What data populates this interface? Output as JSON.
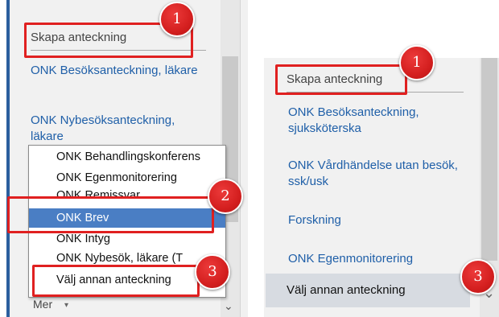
{
  "left": {
    "header": "Skapa anteckning",
    "items": [
      "ONK Besöksanteckning, läkare",
      "ONK Nybesöksanteckning, läkare"
    ],
    "dropdown": [
      {
        "label": "ONK Behandlingskonferens"
      },
      {
        "label": "ONK Egenmonitorering"
      },
      {
        "label": "ONK Remissvar"
      },
      {
        "label": "ONK Brev",
        "selected": true
      },
      {
        "label": "ONK Intyg"
      },
      {
        "label": "ONK Nybesök, läkare (T"
      },
      {
        "label": "Välj annan anteckning"
      }
    ],
    "more_label": "Mer",
    "more_caret": "▾",
    "scroll_down": "⌄"
  },
  "right": {
    "header": "Skapa anteckning",
    "items": [
      "ONK Besöksanteckning, sjuksköterska",
      "ONK Vårdhändelse utan besök, ssk/usk",
      "Forskning",
      "ONK Egenmonitorering"
    ],
    "other_label": "Välj annan anteckning",
    "scroll_down": "⌄"
  },
  "badges": [
    "1",
    "2",
    "3",
    "1",
    "3"
  ],
  "colors": {
    "accent": "#2b5f9e",
    "link": "#1f5fa8",
    "selected": "#4a7ec4",
    "annotation": "#e02020"
  }
}
